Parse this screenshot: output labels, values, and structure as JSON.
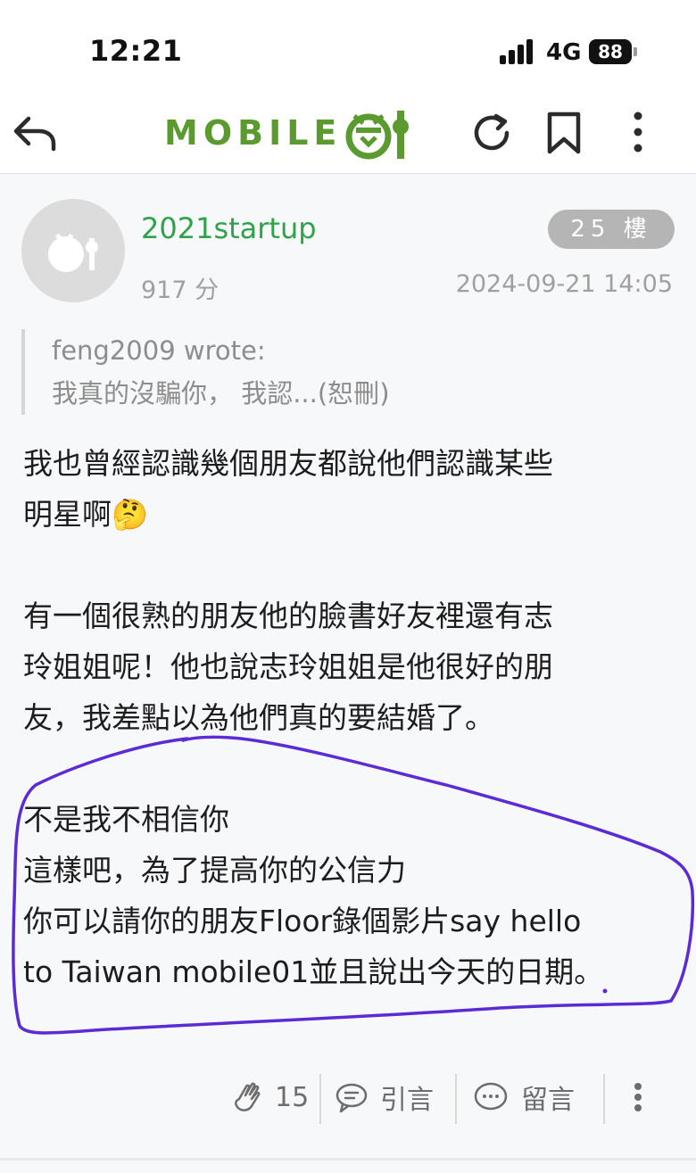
{
  "status_bar": {
    "time": "12:21",
    "network": "4G",
    "battery": "88"
  },
  "nav": {
    "logo_text": "MOBILE",
    "icons": [
      "back-arrow-icon",
      "refresh-icon",
      "bookmark-icon",
      "more-vertical-icon"
    ],
    "accent_color": "#5a9a2e"
  },
  "post": {
    "username": "2021startup",
    "score": "917 分",
    "floor": "25 樓",
    "date": "2024-09-21 14:05",
    "quote": {
      "line1": "feng2009 wrote:",
      "line2": "我真的沒騙你， 我認...(恕刪)"
    },
    "lines": {
      "l1": "我也曾經認識幾個朋友都說他們認識某些",
      "l2": "明星啊🤔",
      "l3": "有一個很熟的朋友他的臉書好友裡還有志",
      "l4": "玲姐姐呢！他也說志玲姐姐是他很好的朋",
      "l5": "友，我差點以為他們真的要結婚了。",
      "l6": "不是我不相信你",
      "l7": "這樣吧，為了提高你的公信力",
      "l8": "你可以請你的朋友Floor錄個影片say hello",
      "l9": "to Taiwan mobile01並且說出今天的日期。"
    },
    "annotation_color": "#5b2bd6"
  },
  "actions": {
    "likes": "15",
    "quote_label": "引言",
    "comment_label": "留言"
  }
}
